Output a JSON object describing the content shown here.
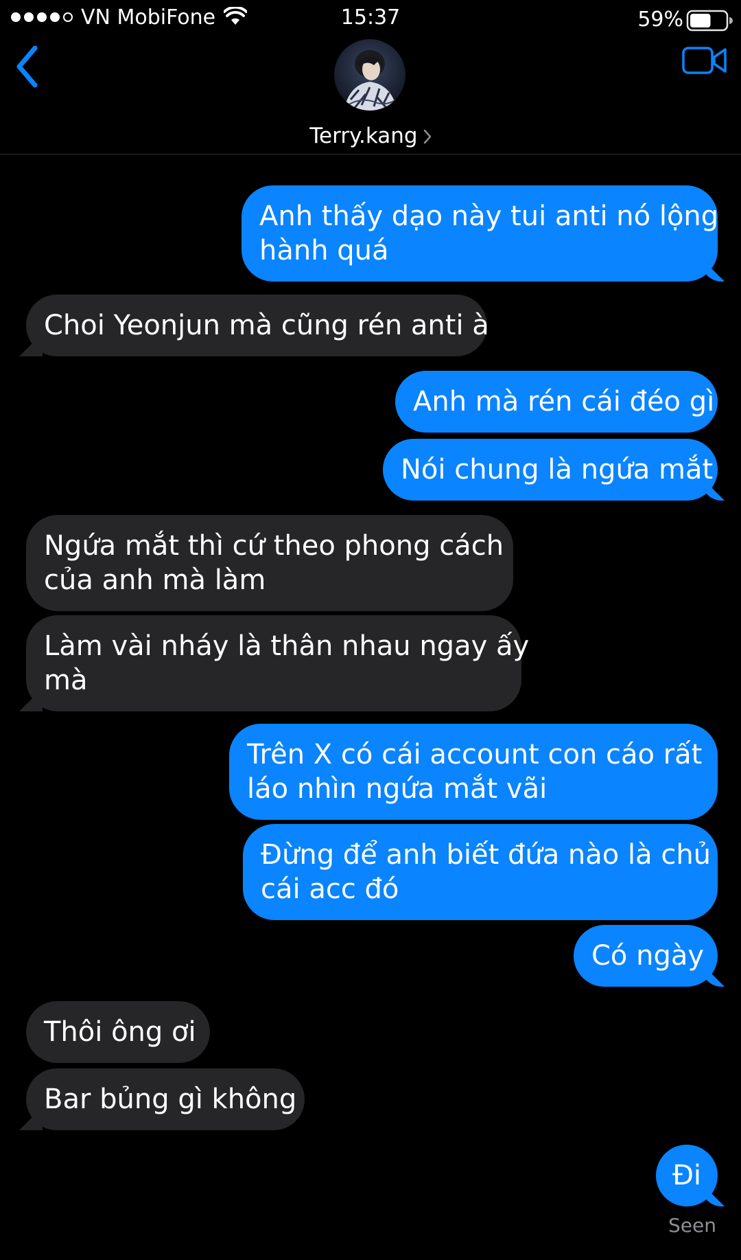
{
  "status_bar": {
    "carrier": "VN MobiFone",
    "time": "15:37",
    "battery": "59%",
    "battery_level": 0.59,
    "signal_bars": 4,
    "signal_max": 5
  },
  "header": {
    "back_icon": "chevron-left-icon",
    "contact_name": "Terry.kang",
    "video_icon": "video-camera-icon"
  },
  "colors": {
    "sent_bubble": "#0a84ff",
    "received_bubble": "#262628",
    "accent": "#0a84ff",
    "background": "#000000"
  },
  "messages": [
    {
      "direction": "sent",
      "lines": [
        "Anh thấy dạo này tui anti nó lộng",
        "hành quá"
      ]
    },
    {
      "direction": "received",
      "lines": [
        "Choi Yeonjun mà cũng rén anti à"
      ]
    },
    {
      "direction": "sent",
      "lines": [
        "Anh mà rén cái đéo gì"
      ]
    },
    {
      "direction": "sent",
      "lines": [
        "Nói chung là ngứa mắt"
      ]
    },
    {
      "direction": "received",
      "lines": [
        "Ngứa mắt thì cứ theo phong cách",
        "của anh mà làm"
      ]
    },
    {
      "direction": "received",
      "lines": [
        "Làm vài nháy là thân nhau ngay ấy",
        "mà"
      ]
    },
    {
      "direction": "sent",
      "lines": [
        "Trên X có cái account con cáo rất",
        "láo nhìn ngứa mắt vãi"
      ]
    },
    {
      "direction": "sent",
      "lines": [
        "Đừng để anh biết đứa nào là chủ",
        "cái acc đó"
      ]
    },
    {
      "direction": "sent",
      "lines": [
        "Có ngày"
      ]
    },
    {
      "direction": "received",
      "lines": [
        "Thôi ông ơi"
      ]
    },
    {
      "direction": "received",
      "lines": [
        "Bar bủng gì không"
      ]
    },
    {
      "direction": "sent",
      "lines": [
        "Đi"
      ]
    }
  ],
  "receipt": "Seen"
}
